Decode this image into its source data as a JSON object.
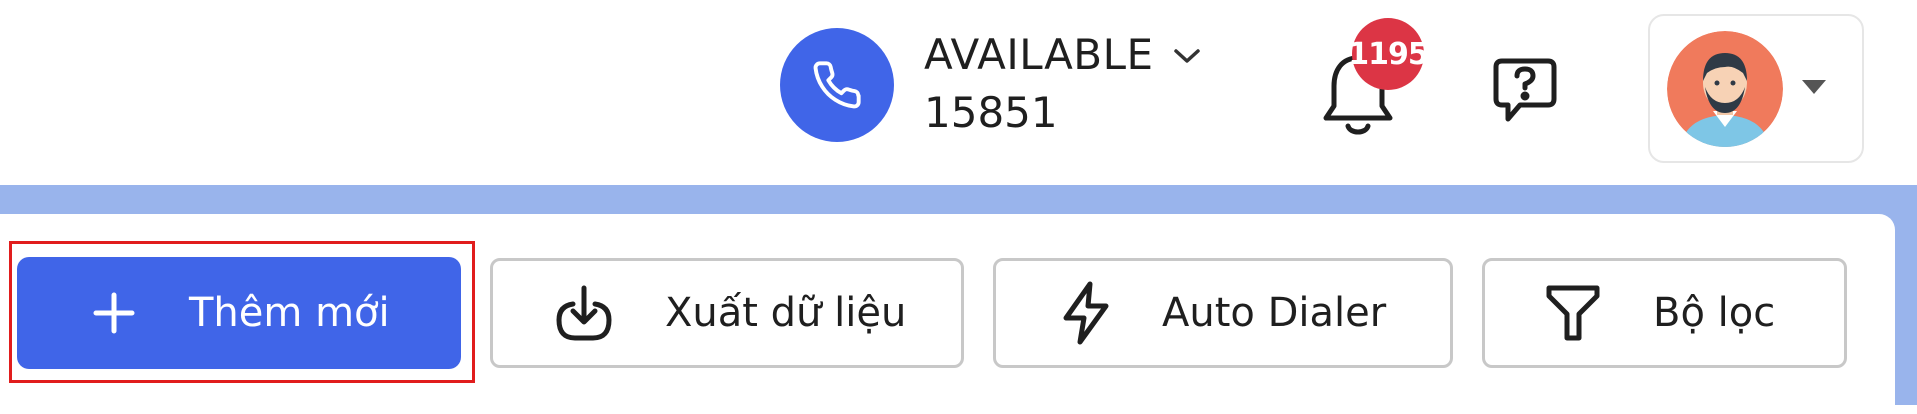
{
  "header": {
    "status": {
      "label": "AVAILABLE",
      "extension": "15851",
      "icon": "phone-icon",
      "circle_color": "#4065e8"
    },
    "notifications": {
      "icon": "bell-icon",
      "badge_count": "1195",
      "badge_color": "#dc3545"
    },
    "help": {
      "icon": "help-chat-icon"
    },
    "profile": {
      "avatar": "user-avatar",
      "menu_icon": "caret-down-icon"
    }
  },
  "toolbar": {
    "accent_color": "#4065e8",
    "buttons": [
      {
        "label": "Thêm mới",
        "icon": "plus-icon"
      },
      {
        "label": "Xuất dữ liệu",
        "icon": "download-icon"
      },
      {
        "label": "Auto Dialer",
        "icon": "lightning-icon"
      },
      {
        "label": "Bộ lọc",
        "icon": "filter-icon"
      }
    ]
  }
}
